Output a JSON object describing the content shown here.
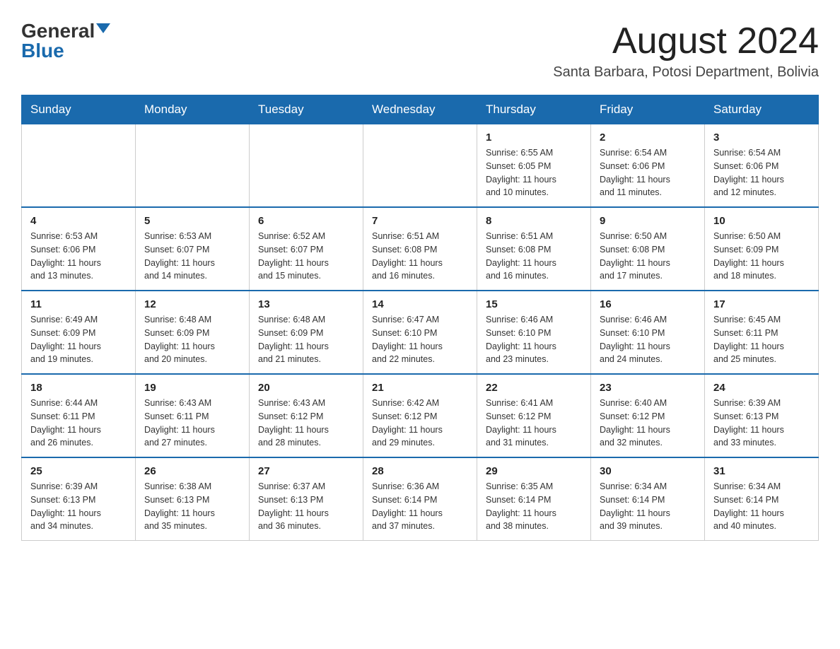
{
  "logo": {
    "general": "General",
    "blue": "Blue"
  },
  "title": {
    "month": "August 2024",
    "location": "Santa Barbara, Potosi Department, Bolivia"
  },
  "days_of_week": [
    "Sunday",
    "Monday",
    "Tuesday",
    "Wednesday",
    "Thursday",
    "Friday",
    "Saturday"
  ],
  "weeks": [
    [
      {
        "day": "",
        "info": ""
      },
      {
        "day": "",
        "info": ""
      },
      {
        "day": "",
        "info": ""
      },
      {
        "day": "",
        "info": ""
      },
      {
        "day": "1",
        "info": "Sunrise: 6:55 AM\nSunset: 6:05 PM\nDaylight: 11 hours\nand 10 minutes."
      },
      {
        "day": "2",
        "info": "Sunrise: 6:54 AM\nSunset: 6:06 PM\nDaylight: 11 hours\nand 11 minutes."
      },
      {
        "day": "3",
        "info": "Sunrise: 6:54 AM\nSunset: 6:06 PM\nDaylight: 11 hours\nand 12 minutes."
      }
    ],
    [
      {
        "day": "4",
        "info": "Sunrise: 6:53 AM\nSunset: 6:06 PM\nDaylight: 11 hours\nand 13 minutes."
      },
      {
        "day": "5",
        "info": "Sunrise: 6:53 AM\nSunset: 6:07 PM\nDaylight: 11 hours\nand 14 minutes."
      },
      {
        "day": "6",
        "info": "Sunrise: 6:52 AM\nSunset: 6:07 PM\nDaylight: 11 hours\nand 15 minutes."
      },
      {
        "day": "7",
        "info": "Sunrise: 6:51 AM\nSunset: 6:08 PM\nDaylight: 11 hours\nand 16 minutes."
      },
      {
        "day": "8",
        "info": "Sunrise: 6:51 AM\nSunset: 6:08 PM\nDaylight: 11 hours\nand 16 minutes."
      },
      {
        "day": "9",
        "info": "Sunrise: 6:50 AM\nSunset: 6:08 PM\nDaylight: 11 hours\nand 17 minutes."
      },
      {
        "day": "10",
        "info": "Sunrise: 6:50 AM\nSunset: 6:09 PM\nDaylight: 11 hours\nand 18 minutes."
      }
    ],
    [
      {
        "day": "11",
        "info": "Sunrise: 6:49 AM\nSunset: 6:09 PM\nDaylight: 11 hours\nand 19 minutes."
      },
      {
        "day": "12",
        "info": "Sunrise: 6:48 AM\nSunset: 6:09 PM\nDaylight: 11 hours\nand 20 minutes."
      },
      {
        "day": "13",
        "info": "Sunrise: 6:48 AM\nSunset: 6:09 PM\nDaylight: 11 hours\nand 21 minutes."
      },
      {
        "day": "14",
        "info": "Sunrise: 6:47 AM\nSunset: 6:10 PM\nDaylight: 11 hours\nand 22 minutes."
      },
      {
        "day": "15",
        "info": "Sunrise: 6:46 AM\nSunset: 6:10 PM\nDaylight: 11 hours\nand 23 minutes."
      },
      {
        "day": "16",
        "info": "Sunrise: 6:46 AM\nSunset: 6:10 PM\nDaylight: 11 hours\nand 24 minutes."
      },
      {
        "day": "17",
        "info": "Sunrise: 6:45 AM\nSunset: 6:11 PM\nDaylight: 11 hours\nand 25 minutes."
      }
    ],
    [
      {
        "day": "18",
        "info": "Sunrise: 6:44 AM\nSunset: 6:11 PM\nDaylight: 11 hours\nand 26 minutes."
      },
      {
        "day": "19",
        "info": "Sunrise: 6:43 AM\nSunset: 6:11 PM\nDaylight: 11 hours\nand 27 minutes."
      },
      {
        "day": "20",
        "info": "Sunrise: 6:43 AM\nSunset: 6:12 PM\nDaylight: 11 hours\nand 28 minutes."
      },
      {
        "day": "21",
        "info": "Sunrise: 6:42 AM\nSunset: 6:12 PM\nDaylight: 11 hours\nand 29 minutes."
      },
      {
        "day": "22",
        "info": "Sunrise: 6:41 AM\nSunset: 6:12 PM\nDaylight: 11 hours\nand 31 minutes."
      },
      {
        "day": "23",
        "info": "Sunrise: 6:40 AM\nSunset: 6:12 PM\nDaylight: 11 hours\nand 32 minutes."
      },
      {
        "day": "24",
        "info": "Sunrise: 6:39 AM\nSunset: 6:13 PM\nDaylight: 11 hours\nand 33 minutes."
      }
    ],
    [
      {
        "day": "25",
        "info": "Sunrise: 6:39 AM\nSunset: 6:13 PM\nDaylight: 11 hours\nand 34 minutes."
      },
      {
        "day": "26",
        "info": "Sunrise: 6:38 AM\nSunset: 6:13 PM\nDaylight: 11 hours\nand 35 minutes."
      },
      {
        "day": "27",
        "info": "Sunrise: 6:37 AM\nSunset: 6:13 PM\nDaylight: 11 hours\nand 36 minutes."
      },
      {
        "day": "28",
        "info": "Sunrise: 6:36 AM\nSunset: 6:14 PM\nDaylight: 11 hours\nand 37 minutes."
      },
      {
        "day": "29",
        "info": "Sunrise: 6:35 AM\nSunset: 6:14 PM\nDaylight: 11 hours\nand 38 minutes."
      },
      {
        "day": "30",
        "info": "Sunrise: 6:34 AM\nSunset: 6:14 PM\nDaylight: 11 hours\nand 39 minutes."
      },
      {
        "day": "31",
        "info": "Sunrise: 6:34 AM\nSunset: 6:14 PM\nDaylight: 11 hours\nand 40 minutes."
      }
    ]
  ]
}
